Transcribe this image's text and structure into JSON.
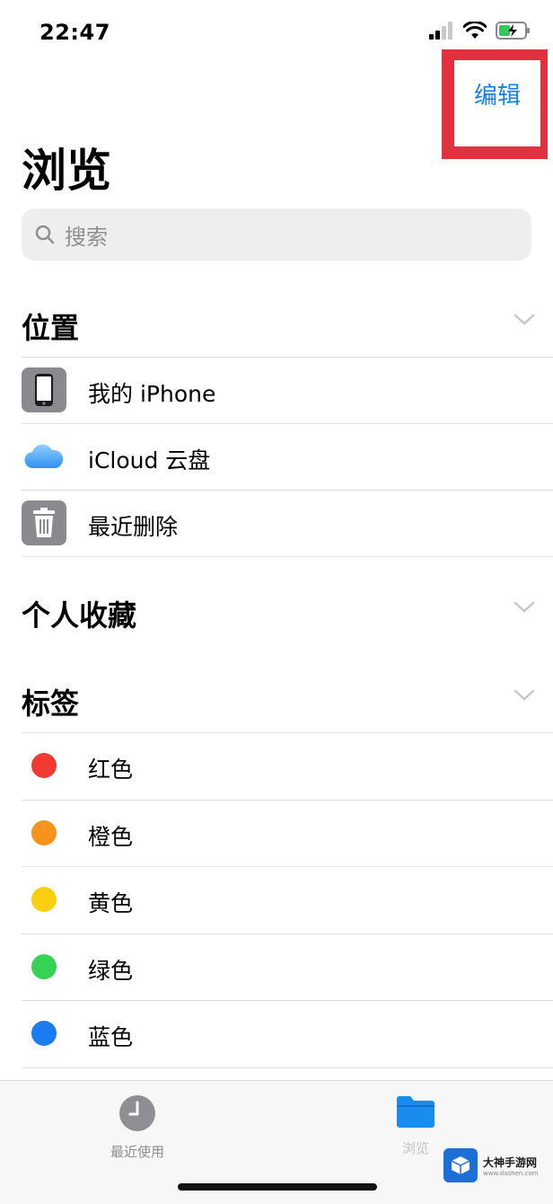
{
  "status_bar": {
    "time": "22:47"
  },
  "nav": {
    "edit_label": "编辑",
    "title": "浏览"
  },
  "search": {
    "placeholder": "搜索"
  },
  "sections": {
    "locations": {
      "title": "位置"
    },
    "favorites": {
      "title": "个人收藏"
    },
    "tags": {
      "title": "标签"
    }
  },
  "locations": [
    {
      "label": "我的 iPhone",
      "icon": "iphone-icon"
    },
    {
      "label": "iCloud 云盘",
      "icon": "icloud-icon"
    },
    {
      "label": "最近删除",
      "icon": "trash-icon"
    }
  ],
  "tags": [
    {
      "label": "红色",
      "color": "#f23a32"
    },
    {
      "label": "橙色",
      "color": "#f5941d"
    },
    {
      "label": "黄色",
      "color": "#f9cf12"
    },
    {
      "label": "绿色",
      "color": "#35d255"
    },
    {
      "label": "蓝色",
      "color": "#1b7cf2"
    }
  ],
  "tab_bar": {
    "recents_label": "最近使用",
    "browse_label": "浏览"
  },
  "watermark": {
    "title": "大神手游网",
    "subtitle": "www.dashen.com"
  }
}
